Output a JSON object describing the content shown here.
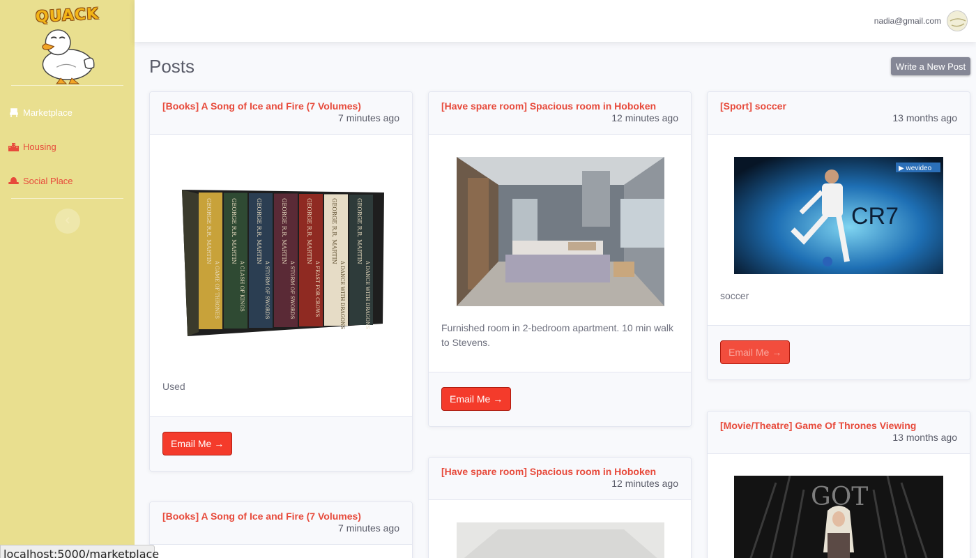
{
  "brand": {
    "name": "QUACK"
  },
  "sidebar": {
    "items": [
      {
        "label": "Marketplace",
        "icon": "chair-icon",
        "active": true
      },
      {
        "label": "Housing",
        "icon": "building-icon",
        "active": false
      },
      {
        "label": "Social Place",
        "icon": "hat-icon",
        "active": false
      }
    ],
    "toggle_icon": "chevron-left-icon"
  },
  "topbar": {
    "user_email": "nadia@gmail.com"
  },
  "main": {
    "title": "Posts",
    "new_post_label": "Write a New Post"
  },
  "posts": [
    {
      "title": "[Books] A Song of Ice and Fire (7 Volumes)",
      "time": "7 minutes ago",
      "description": "Used",
      "button": "Email Me →",
      "image": "book-box-set"
    },
    {
      "title": "[Have spare room] Spacious room in Hoboken",
      "time": "12 minutes ago",
      "description": "Furnished room in 2-bedroom apartment. 10 min walk to Stevens.",
      "button": "Email Me →",
      "image": "bedroom"
    },
    {
      "title": "[Sport] soccer",
      "time": "13 months ago",
      "description": "soccer",
      "button": "Email Me →",
      "image": "soccer-player"
    },
    {
      "title": "[Movie/Theatre] Game Of Thrones Viewing",
      "time": "13 months ago",
      "image": "got-poster"
    },
    {
      "title": "[Books] A Song of Ice and Fire (7 Volumes)",
      "time": "7 minutes ago"
    },
    {
      "title": "[Have spare room] Spacious room in Hoboken",
      "time": "12 minutes ago",
      "image": "room-ceiling"
    }
  ],
  "images": {
    "book_spine_label": "GEORGE R.R. MARTIN",
    "book_titles": [
      "A GAME OF THRONES",
      "A CLASH OF KINGS",
      "A STORM OF SWORDS",
      "A STORM OF SWORDS",
      "A FEAST FOR CROWS",
      "A DANCE WITH DRAGONS",
      "A DANCE WITH DRAGONS"
    ],
    "soccer_watermark": "▶ wevideo",
    "soccer_text": "CR7",
    "got_text": "GOT"
  },
  "status_bar": {
    "url": "localhost:5000/marketplace"
  },
  "colors": {
    "sidebar": "#e9df8f",
    "accent": "#e74a3b",
    "button": "#f43b2b",
    "secondary": "#858796"
  }
}
